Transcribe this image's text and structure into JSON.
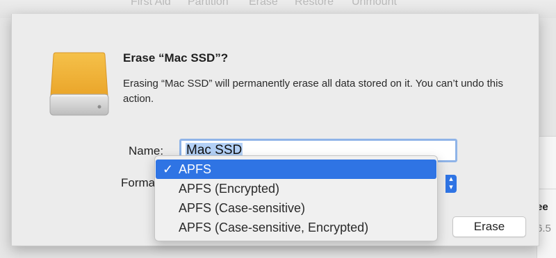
{
  "toolbar": {
    "items": [
      "First Aid",
      "Partition",
      "Erase",
      "Restore",
      "Unmount"
    ]
  },
  "background": {
    "partial_label": "ee",
    "partial_value": "6.5"
  },
  "dialog": {
    "title": "Erase “Mac SSD”?",
    "message": "Erasing “Mac SSD” will permanently erase all data stored on it. You can’t undo this action.",
    "name_label": "Name:",
    "name_value": "Mac SSD",
    "format_label": "Format",
    "erase_button": "Erase"
  },
  "format_menu": {
    "check_mark": "✓",
    "options": [
      {
        "label": "APFS",
        "selected": true
      },
      {
        "label": "APFS (Encrypted)",
        "selected": false
      },
      {
        "label": "APFS (Case-sensitive)",
        "selected": false
      },
      {
        "label": "APFS (Case-sensitive, Encrypted)",
        "selected": false
      }
    ]
  },
  "colors": {
    "accent": "#2f74e4",
    "disk_body": "#f0b43a",
    "selection": "#b3d0f6"
  },
  "icons": [
    "external-drive-icon",
    "checkmark-icon",
    "chevron-updown-icon"
  ]
}
